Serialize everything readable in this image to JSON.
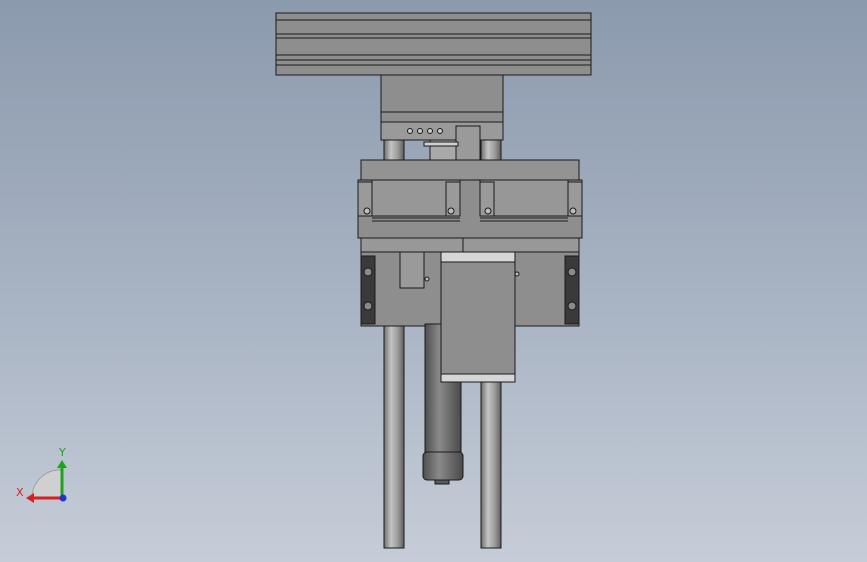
{
  "triad": {
    "x_label": "X",
    "y_label": "Y",
    "colors": {
      "x": "#d42020",
      "y": "#1fa31f",
      "z": "#2233cc"
    }
  },
  "colors": {
    "body": "#8e8e8e",
    "body_light": "#9b9b9b",
    "body_dark": "#6f6f6f",
    "outline": "#1a1a1a",
    "rod": "#a8a8a8",
    "rod_dark": "#7a7a7a",
    "insert": "#3a3a3a"
  }
}
